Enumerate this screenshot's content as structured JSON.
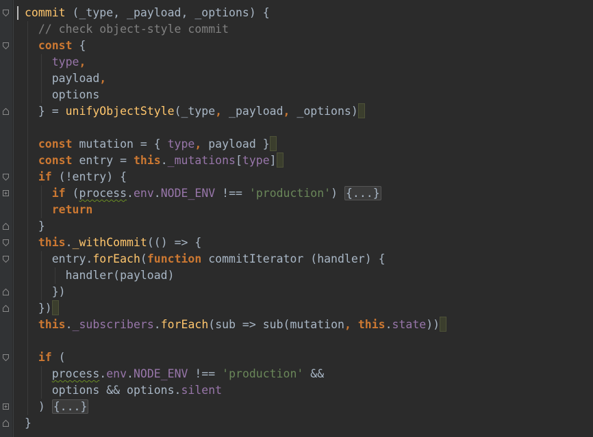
{
  "lines": [
    [
      {
        "t": "commit ",
        "c": "fn"
      },
      {
        "t": "(_type, _payload, _options) {",
        "c": "plain"
      }
    ],
    [
      {
        "t": "  // check object-style commit",
        "c": "cmt"
      }
    ],
    [
      {
        "t": "  ",
        "c": "plain"
      },
      {
        "t": "const",
        "c": "kw"
      },
      {
        "t": " {",
        "c": "plain"
      }
    ],
    [
      {
        "t": "    ",
        "c": "plain"
      },
      {
        "t": "type",
        "c": "prop"
      },
      {
        "t": ",",
        "c": "kw"
      }
    ],
    [
      {
        "t": "    payload",
        "c": "plain"
      },
      {
        "t": ",",
        "c": "kw"
      }
    ],
    [
      {
        "t": "    options",
        "c": "plain"
      }
    ],
    [
      {
        "t": "  } = ",
        "c": "plain"
      },
      {
        "t": "unifyObjectStyle",
        "c": "fn"
      },
      {
        "t": "(_type",
        "c": "plain"
      },
      {
        "t": ",",
        "c": "kw"
      },
      {
        "t": " _payload",
        "c": "plain"
      },
      {
        "t": ",",
        "c": "kw"
      },
      {
        "t": " _options)",
        "c": "plain"
      },
      {
        "m": true
      }
    ],
    [],
    [
      {
        "t": "  ",
        "c": "plain"
      },
      {
        "t": "const",
        "c": "kw"
      },
      {
        "t": " mutation = { ",
        "c": "plain"
      },
      {
        "t": "type",
        "c": "prop"
      },
      {
        "t": ",",
        "c": "kw"
      },
      {
        "t": " payload }",
        "c": "plain"
      },
      {
        "m": true
      }
    ],
    [
      {
        "t": "  ",
        "c": "plain"
      },
      {
        "t": "const",
        "c": "kw"
      },
      {
        "t": " entry = ",
        "c": "plain"
      },
      {
        "t": "this",
        "c": "kw"
      },
      {
        "t": ".",
        "c": "plain"
      },
      {
        "t": "_mutations",
        "c": "prop"
      },
      {
        "t": "[",
        "c": "plain"
      },
      {
        "t": "type",
        "c": "prop"
      },
      {
        "t": "]",
        "c": "plain"
      },
      {
        "m": true
      }
    ],
    [
      {
        "t": "  ",
        "c": "plain"
      },
      {
        "t": "if",
        "c": "kw"
      },
      {
        "t": " (!entry) {",
        "c": "plain"
      }
    ],
    [
      {
        "t": "    ",
        "c": "plain"
      },
      {
        "t": "if",
        "c": "kw"
      },
      {
        "t": " (",
        "c": "plain"
      },
      {
        "t": "process",
        "c": "plain",
        "s": true
      },
      {
        "t": ".",
        "c": "plain"
      },
      {
        "t": "env",
        "c": "prop"
      },
      {
        "t": ".",
        "c": "plain"
      },
      {
        "t": "NODE_ENV",
        "c": "prop"
      },
      {
        "t": " !== ",
        "c": "plain"
      },
      {
        "t": "'production'",
        "c": "str"
      },
      {
        "t": ") ",
        "c": "plain"
      },
      {
        "t": "{...}",
        "c": "fold"
      }
    ],
    [
      {
        "t": "    ",
        "c": "plain"
      },
      {
        "t": "return",
        "c": "kw"
      }
    ],
    [
      {
        "t": "  }",
        "c": "plain"
      }
    ],
    [
      {
        "t": "  ",
        "c": "plain"
      },
      {
        "t": "this",
        "c": "kw"
      },
      {
        "t": ".",
        "c": "plain"
      },
      {
        "t": "_withCommit",
        "c": "fn"
      },
      {
        "t": "(() => {",
        "c": "plain"
      }
    ],
    [
      {
        "t": "    entry.",
        "c": "plain"
      },
      {
        "t": "forEach",
        "c": "fn"
      },
      {
        "t": "(",
        "c": "plain"
      },
      {
        "t": "function",
        "c": "kw"
      },
      {
        "t": " commitIterator (handler) {",
        "c": "plain"
      }
    ],
    [
      {
        "t": "      handler(payload)",
        "c": "plain"
      }
    ],
    [
      {
        "t": "    })",
        "c": "plain"
      }
    ],
    [
      {
        "t": "  })",
        "c": "plain"
      },
      {
        "m": true
      }
    ],
    [
      {
        "t": "  ",
        "c": "plain"
      },
      {
        "t": "this",
        "c": "kw"
      },
      {
        "t": ".",
        "c": "plain"
      },
      {
        "t": "_subscribers",
        "c": "prop"
      },
      {
        "t": ".",
        "c": "plain"
      },
      {
        "t": "forEach",
        "c": "fn"
      },
      {
        "t": "(sub => sub(mutation",
        "c": "plain"
      },
      {
        "t": ",",
        "c": "kw"
      },
      {
        "t": " ",
        "c": "plain"
      },
      {
        "t": "this",
        "c": "kw"
      },
      {
        "t": ".",
        "c": "plain"
      },
      {
        "t": "state",
        "c": "prop"
      },
      {
        "t": "))",
        "c": "plain"
      },
      {
        "m": true
      }
    ],
    [],
    [
      {
        "t": "  ",
        "c": "plain"
      },
      {
        "t": "if",
        "c": "kw"
      },
      {
        "t": " (",
        "c": "plain"
      }
    ],
    [
      {
        "t": "    ",
        "c": "plain"
      },
      {
        "t": "process",
        "c": "plain",
        "s": true
      },
      {
        "t": ".",
        "c": "plain"
      },
      {
        "t": "env",
        "c": "prop"
      },
      {
        "t": ".",
        "c": "plain"
      },
      {
        "t": "NODE_ENV",
        "c": "prop"
      },
      {
        "t": " !== ",
        "c": "plain"
      },
      {
        "t": "'production'",
        "c": "str"
      },
      {
        "t": " &&",
        "c": "plain"
      }
    ],
    [
      {
        "t": "    options && options.",
        "c": "plain"
      },
      {
        "t": "silent",
        "c": "prop"
      }
    ],
    [
      {
        "t": "  ) ",
        "c": "plain"
      },
      {
        "t": "{...}",
        "c": "fold"
      }
    ],
    [
      {
        "t": "}",
        "c": "plain"
      }
    ]
  ],
  "fold_icons": [
    {
      "line": 0,
      "type": "open"
    },
    {
      "line": 2,
      "type": "open"
    },
    {
      "line": 6,
      "type": "close"
    },
    {
      "line": 10,
      "type": "open"
    },
    {
      "line": 11,
      "type": "collapsed"
    },
    {
      "line": 13,
      "type": "close"
    },
    {
      "line": 14,
      "type": "open"
    },
    {
      "line": 15,
      "type": "open"
    },
    {
      "line": 17,
      "type": "close"
    },
    {
      "line": 18,
      "type": "close"
    },
    {
      "line": 21,
      "type": "open"
    },
    {
      "line": 24,
      "type": "collapsed"
    },
    {
      "line": 25,
      "type": "close"
    }
  ],
  "colors": {
    "background": "#2b2b2b",
    "gutter": "#313335",
    "keyword": "#cc7832",
    "identifier": "#a9b7c6",
    "property": "#9876aa",
    "function": "#ffc66d",
    "string": "#6a8759",
    "comment": "#808080"
  }
}
